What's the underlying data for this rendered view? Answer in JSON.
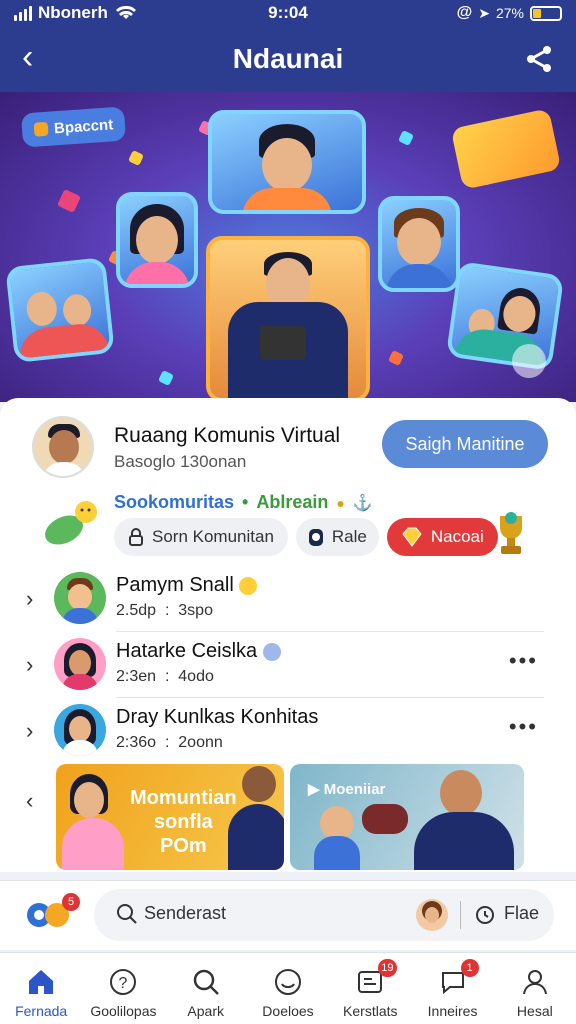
{
  "status_bar": {
    "carrier": "Nbonerh",
    "time": "9::04",
    "battery_text": "27%"
  },
  "header": {
    "title": "Ndaunai"
  },
  "hero": {
    "tag_left": "Bpaccnt"
  },
  "profile": {
    "name": "Ruaang Komunis Virtual",
    "subtitle": "Basoglo  130onan",
    "follow_label": "Saigh Manitine"
  },
  "categories": {
    "primary": "Sookomuritas",
    "secondary": "Ablreain",
    "sep": "•"
  },
  "chips": [
    {
      "label": "Sorn Komunitan",
      "style": "gray",
      "icon": "lock-icon"
    },
    {
      "label": "Rale",
      "style": "gray",
      "icon": "badge-icon"
    },
    {
      "label": "Nacoai",
      "style": "red",
      "icon": "gem-icon"
    }
  ],
  "list": [
    {
      "name": "Pamym Snall",
      "time": "2.5dp",
      "sep": ":",
      "count": "3spo"
    },
    {
      "name": "Hatarke Ceislka",
      "time": "2:3en",
      "sep": ":",
      "count": "4odo"
    },
    {
      "name": "Dray Kunlkas Konhitas",
      "time": "2:36o",
      "sep": ":",
      "count": "2oonn"
    }
  ],
  "cards": [
    {
      "text": "Momuntian\nsonfla\nPOm"
    },
    {
      "text": "Moeniiar"
    }
  ],
  "compose": {
    "badge": "5",
    "search_placeholder": "Senderast",
    "filter_label": "Flae"
  },
  "tabs": [
    {
      "label": "Fernada",
      "icon": "home-icon",
      "active": true,
      "badge": ""
    },
    {
      "label": "Goolilopas",
      "icon": "question-icon",
      "active": false,
      "badge": ""
    },
    {
      "label": "Apark",
      "icon": "search-icon",
      "active": false,
      "badge": ""
    },
    {
      "label": "Doeloes",
      "icon": "emoji-icon",
      "active": false,
      "badge": ""
    },
    {
      "label": "Kerstlats",
      "icon": "notes-icon",
      "active": false,
      "badge": "19"
    },
    {
      "label": "Inneires",
      "icon": "chat-icon",
      "active": false,
      "badge": "1"
    },
    {
      "label": "Hesal",
      "icon": "profile-icon",
      "active": false,
      "badge": ""
    }
  ],
  "colors": {
    "primary": "#2c3d8f",
    "accent": "#5b8ad6",
    "danger": "#e23a3a",
    "tab_active": "#2c55c8"
  }
}
